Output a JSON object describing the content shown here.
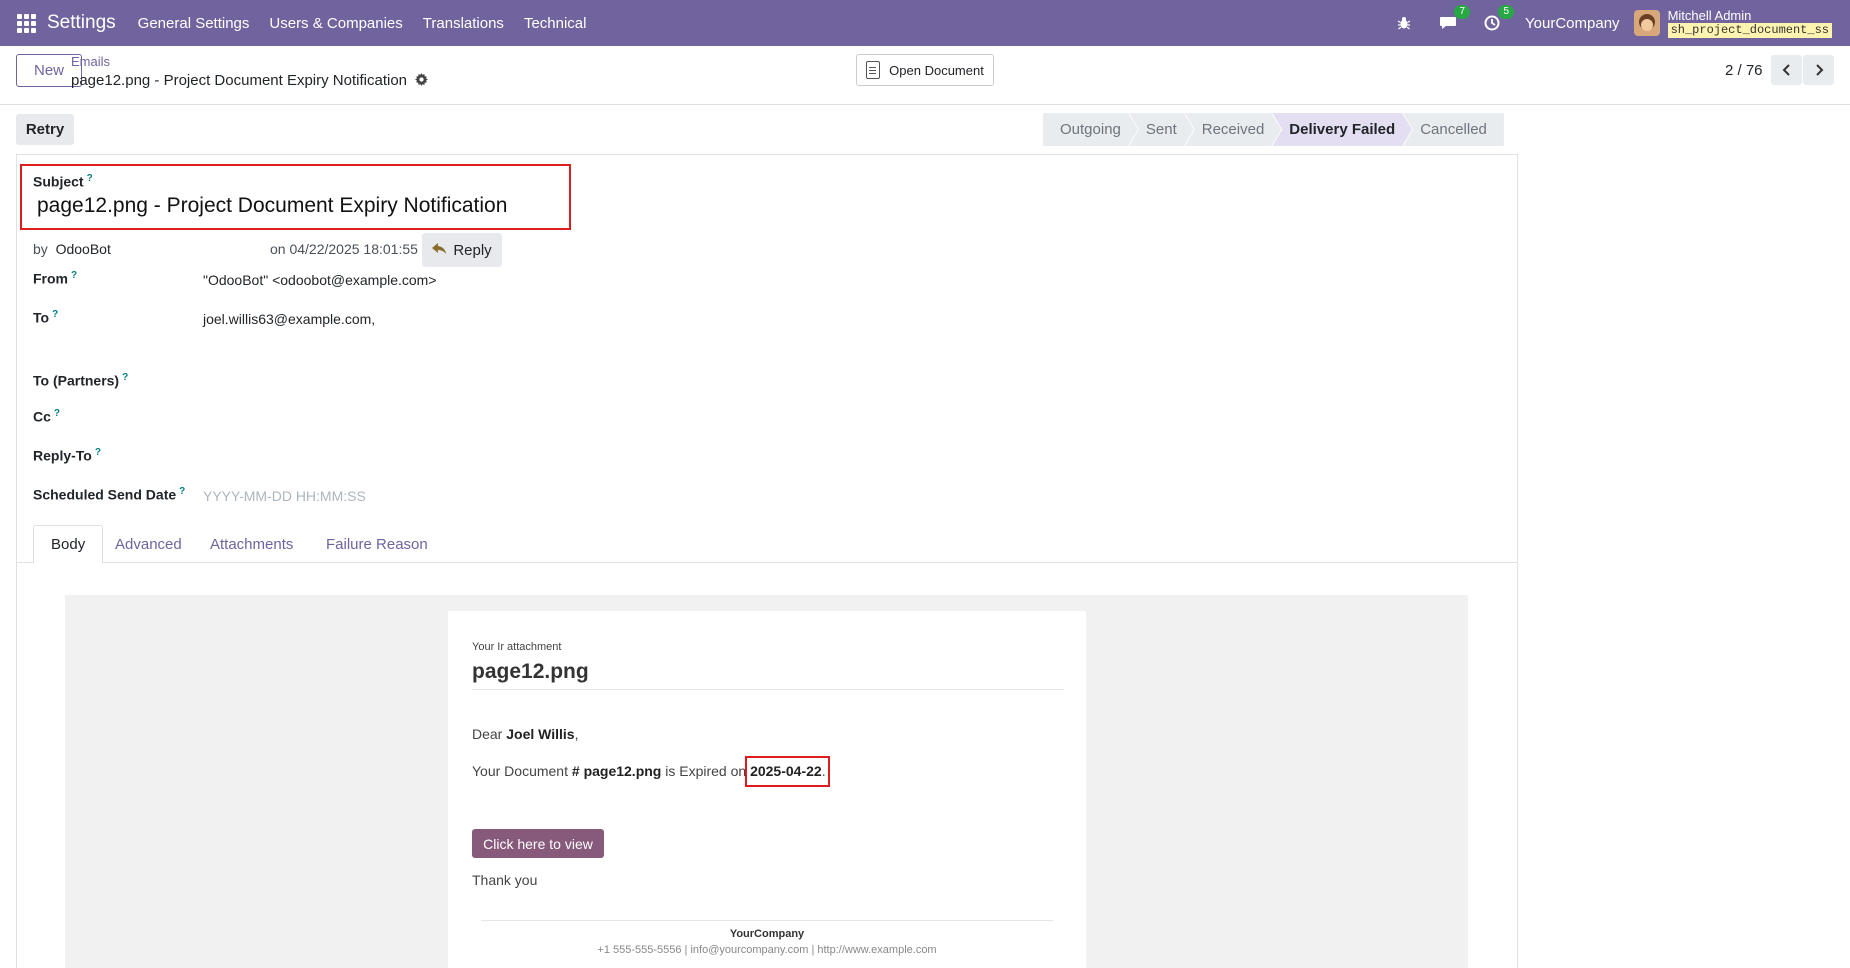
{
  "navbar": {
    "app_name": "Settings",
    "menu": [
      "General Settings",
      "Users & Companies",
      "Translations",
      "Technical"
    ],
    "messages_count": "7",
    "activities_count": "5",
    "company": "YourCompany",
    "user_name": "Mitchell Admin",
    "database": "sh_project_document_ss"
  },
  "control": {
    "new_label": "New",
    "breadcrumb_parent": "Emails",
    "breadcrumb_current": "page12.png - Project Document Expiry Notification",
    "open_document_label": "Open Document",
    "pager": "2 / 76"
  },
  "actions": {
    "retry_label": "Retry"
  },
  "statusbar": {
    "stages": [
      "Outgoing",
      "Sent",
      "Received",
      "Delivery Failed",
      "Cancelled"
    ],
    "active": "Delivery Failed"
  },
  "form": {
    "subject_label": "Subject",
    "subject_value": "page12.png - Project Document Expiry Notification",
    "by_prefix": "by",
    "author": "OdooBot",
    "date_text": "on 04/22/2025 18:01:55",
    "reply_label": "Reply",
    "from_label": "From",
    "from_value": "\"OdooBot\" <odoobot@example.com>",
    "to_label": "To",
    "to_value": "joel.willis63@example.com,",
    "to_partners_label": "To (Partners)",
    "cc_label": "Cc",
    "reply_to_label": "Reply-To",
    "scheduled_label": "Scheduled Send Date",
    "scheduled_placeholder": "YYYY-MM-DD HH:MM:SS",
    "help_mark": "?"
  },
  "tabs": [
    "Body",
    "Advanced",
    "Attachments",
    "Failure Reason"
  ],
  "email": {
    "small_header": "Your Ir attachment",
    "title": "page12.png",
    "dear_prefix": "Dear",
    "customer_name": "Joel Willis",
    "dear_suffix": ",",
    "doc_prefix": "Your Document",
    "doc_hash": "#",
    "doc_name": "page12.png",
    "doc_middle": "is Expired on",
    "expiry_date": "2025-04-22",
    "doc_suffix": ".",
    "button_label": "Click here to view",
    "thanks": "Thank you",
    "footer_company": "YourCompany",
    "footer_contact": "+1 555-555-5556 | info@yourcompany.com | http://www.example.com"
  },
  "colors": {
    "navbar": "#71639e",
    "primary": "#71639e",
    "email_button": "#875a7b",
    "highlight_box": "#dc1d1d",
    "badge": "#28a745"
  }
}
